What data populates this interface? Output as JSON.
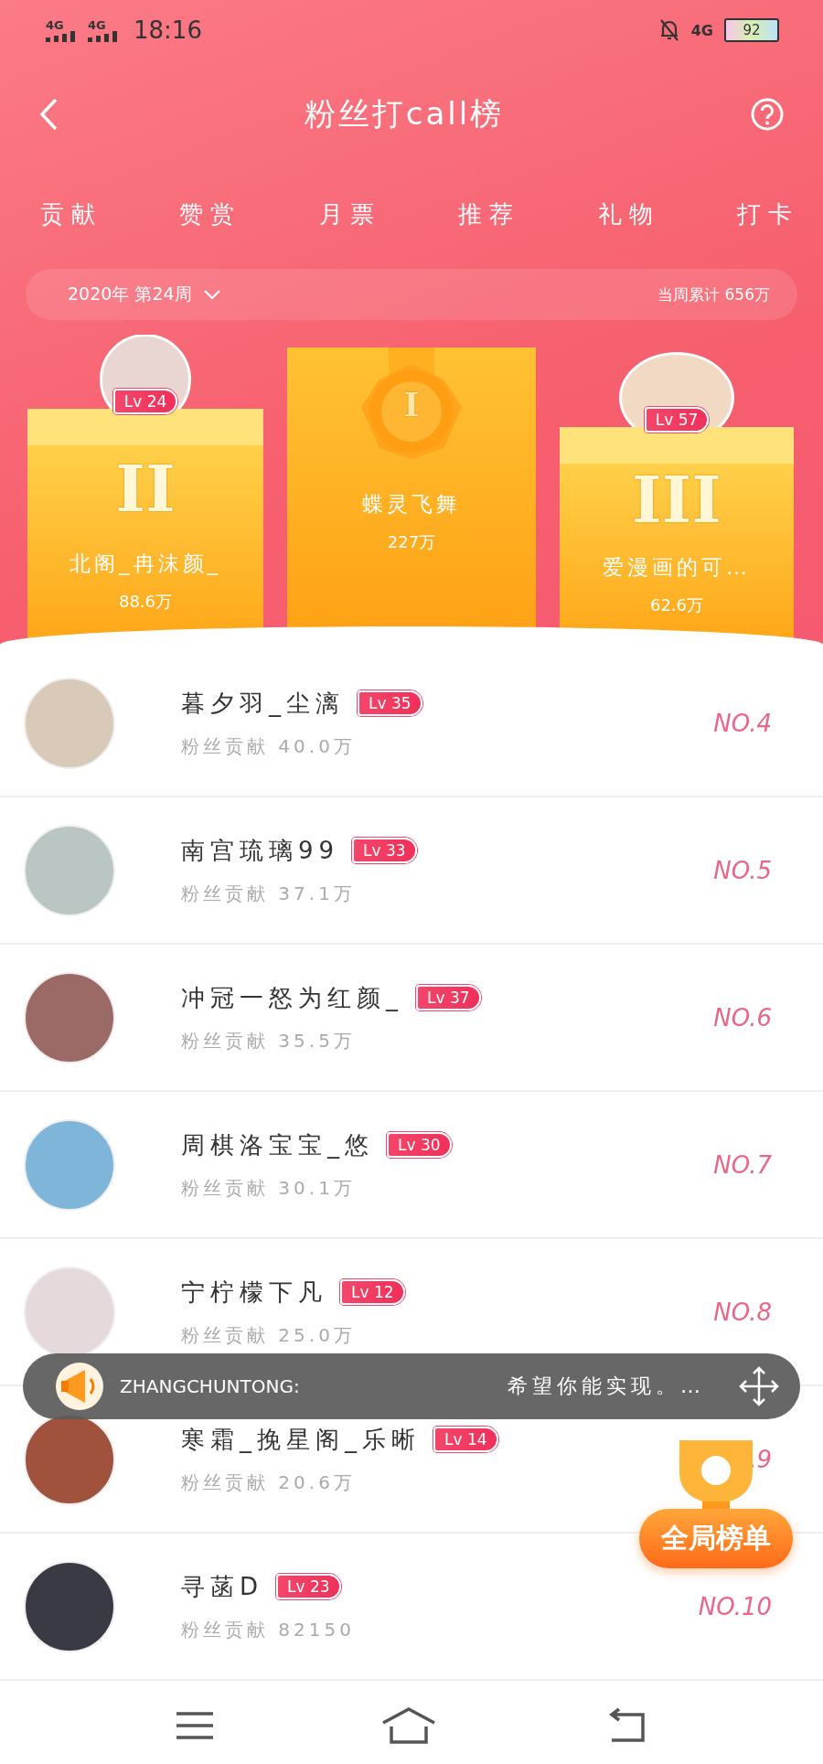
{
  "status_bar": {
    "signals": [
      "4G",
      "4G"
    ],
    "time": "18:16",
    "network": "4G",
    "battery": "92"
  },
  "header": {
    "title": "粉丝打call榜"
  },
  "tabs": [
    {
      "label": "贡献"
    },
    {
      "label": "赞赏"
    },
    {
      "label": "月票"
    },
    {
      "label": "推荐"
    },
    {
      "label": "礼物"
    },
    {
      "label": "打卡"
    }
  ],
  "week_bar": {
    "week": "2020年 第24周",
    "total": "当周累计 656万"
  },
  "podium": [
    {
      "kind": "avatar",
      "level": "Lv 24",
      "place": "II",
      "name": "北阁_冉沫颜_",
      "score": "88.6万"
    },
    {
      "kind": "medal",
      "place": "I",
      "name": "蝶灵飞舞",
      "score": "227万"
    },
    {
      "kind": "avatar",
      "level": "Lv 57",
      "place": "III",
      "name": "爱漫画的可…",
      "score": "62.6万"
    }
  ],
  "rows": [
    {
      "name": "暮夕羽_尘漓",
      "level": "Lv 35",
      "contribution": "粉丝贡献 40.0万",
      "rank": "NO.4",
      "color": "#d8c9b8"
    },
    {
      "name": "南宫琉璃99",
      "level": "Lv 33",
      "contribution": "粉丝贡献 37.1万",
      "rank": "NO.5",
      "color": "#b9c6c4"
    },
    {
      "name": "冲冠一怒为红颜_",
      "level": "Lv 37",
      "contribution": "粉丝贡献 35.5万",
      "rank": "NO.6",
      "color": "#9b6a66"
    },
    {
      "name": "周棋洛宝宝_悠",
      "level": "Lv 30",
      "contribution": "粉丝贡献 30.1万",
      "rank": "NO.7",
      "color": "#7fb5d9"
    },
    {
      "name": "宁柠檬下凡",
      "level": "Lv 12",
      "contribution": "粉丝贡献 25.0万",
      "rank": "NO.8",
      "color": "#e6d9dc"
    },
    {
      "name": "寒霜_挽星阁_乐晰",
      "level": "Lv 14",
      "contribution": "粉丝贡献 20.6万",
      "rank": ".9",
      "color": "#a0523c"
    },
    {
      "name": "寻菡D",
      "level": "Lv 23",
      "contribution": "粉丝贡献 82150",
      "rank": "NO.10",
      "color": "#3a3a44"
    }
  ],
  "toast": {
    "user": "ZHANGCHUNTONG:",
    "message": "希望你能实现。…"
  },
  "floating_button": {
    "label": "全局榜单"
  }
}
